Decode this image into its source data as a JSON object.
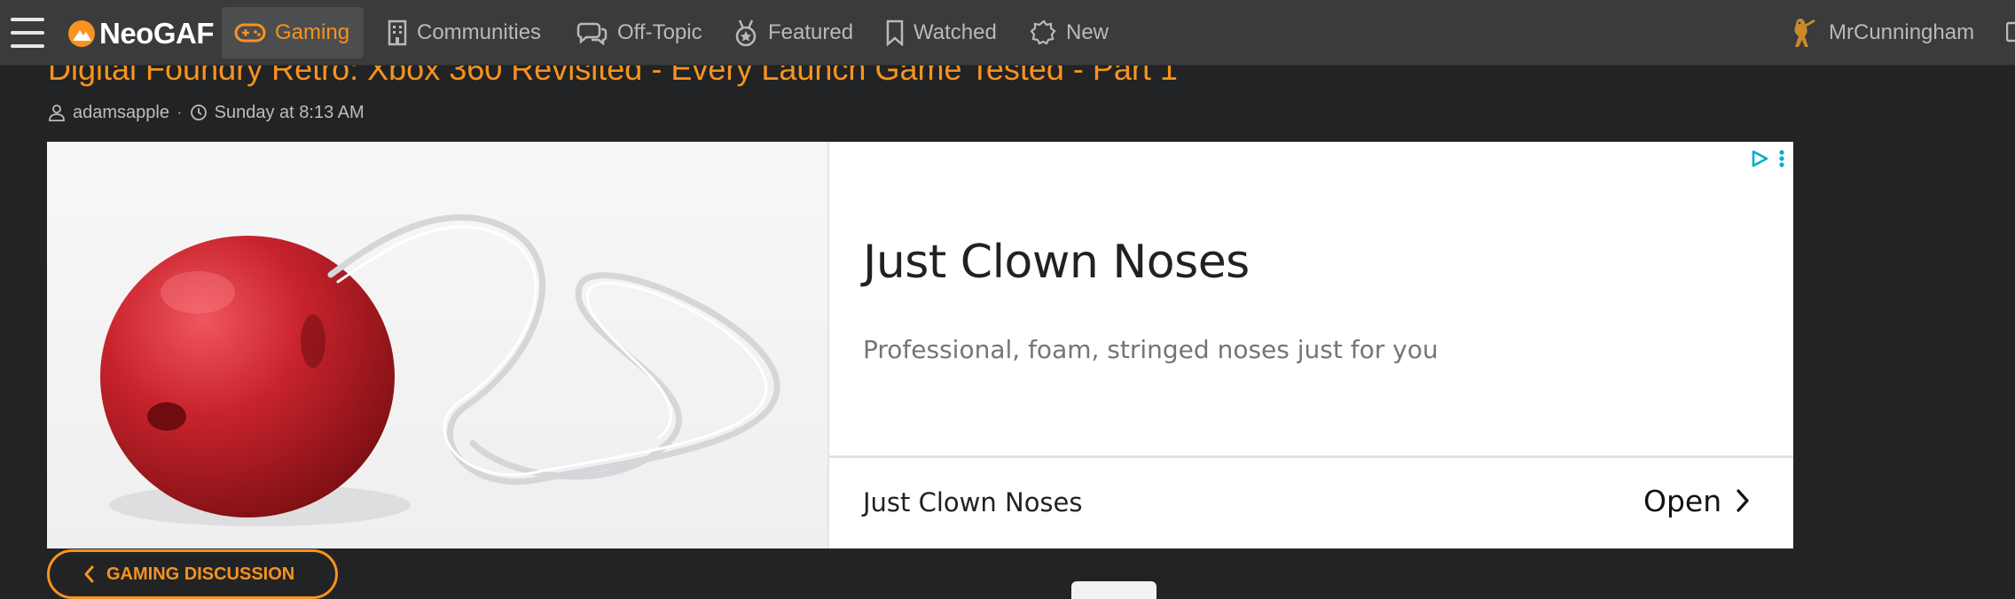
{
  "nav": {
    "logo": "NeoGAF",
    "items": [
      {
        "label": "Gaming",
        "active": true,
        "icon": "gamepad-icon"
      },
      {
        "label": "Communities",
        "active": false,
        "icon": "building-icon"
      },
      {
        "label": "Off-Topic",
        "active": false,
        "icon": "chat-bubbles-icon"
      },
      {
        "label": "Featured",
        "active": false,
        "icon": "medal-icon"
      },
      {
        "label": "Watched",
        "active": false,
        "icon": "bookmark-icon"
      },
      {
        "label": "New",
        "active": false,
        "icon": "spark-icon"
      }
    ],
    "user": "MrCunningham"
  },
  "thread": {
    "title": "Digital Foundry Retro: Xbox 360 Revisited - Every Launch Game Tested - Part 1",
    "author": "adamsapple",
    "separator": "·",
    "time": "Sunday at 8:13 AM"
  },
  "ad": {
    "headline": "Just Clown Noses",
    "description": "Professional, foam, stringed noses just for you",
    "advertiser": "Just Clown Noses",
    "cta": "Open"
  },
  "back_button": {
    "label": "GAMING DISCUSSION"
  },
  "colors": {
    "accent": "#f7931e",
    "topbar": "#3a3b3c",
    "background": "#222324",
    "clown_nose": "#c8232c"
  }
}
